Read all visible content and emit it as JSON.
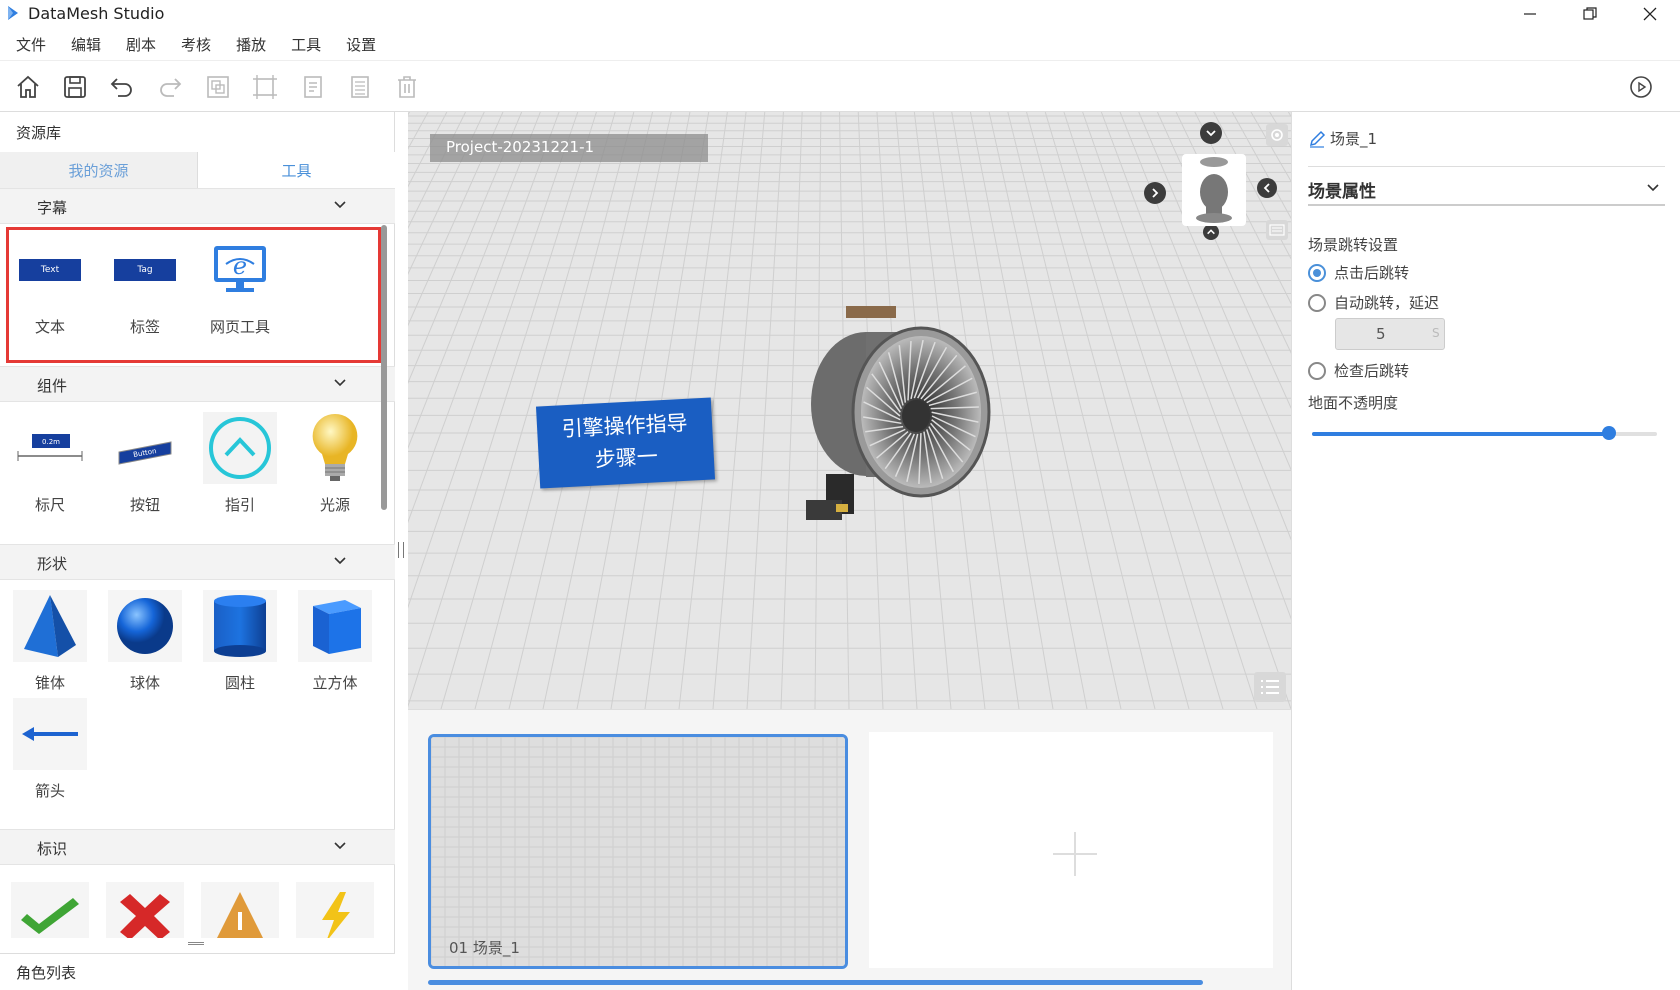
{
  "app": {
    "title": "DataMesh Studio"
  },
  "menu": [
    "文件",
    "编辑",
    "剧本",
    "考核",
    "播放",
    "工具",
    "设置"
  ],
  "left": {
    "header": "资源库",
    "tabs": [
      "我的资源",
      "工具"
    ],
    "sections": {
      "subtitle": {
        "label": "字幕",
        "items": [
          "文本",
          "标签",
          "网页工具"
        ],
        "thumbs": [
          "Text",
          "Tag"
        ]
      },
      "component": {
        "label": "组件",
        "items": [
          "标尺",
          "按钮",
          "指引",
          "光源"
        ],
        "thumbs": [
          "0.2m",
          "Button"
        ]
      },
      "shape": {
        "label": "形状",
        "items": [
          "锥体",
          "球体",
          "圆柱",
          "立方体",
          "箭头"
        ]
      },
      "mark": {
        "label": "标识"
      }
    },
    "role_list": "角色列表"
  },
  "viewport": {
    "project_name": "Project-20231221-1",
    "sign_text_line1": "引擎操作指导",
    "sign_text_line2": "步骤一"
  },
  "storyboard": {
    "scene_caption": "01  场景_1"
  },
  "right": {
    "scene_name": "场景_1",
    "section_title": "场景属性",
    "jump_label": "场景跳转设置",
    "options": [
      "点击后跳转",
      "自动跳转，延迟",
      "检查后跳转"
    ],
    "selected_option": 0,
    "delay_value": "5",
    "delay_unit": "S",
    "opacity_label": "地面不透明度",
    "opacity_value": 0.86
  },
  "colors": {
    "accent": "#2f7ee0",
    "highlight_border": "#e53935",
    "sign_bg": "#1a5ec2"
  }
}
